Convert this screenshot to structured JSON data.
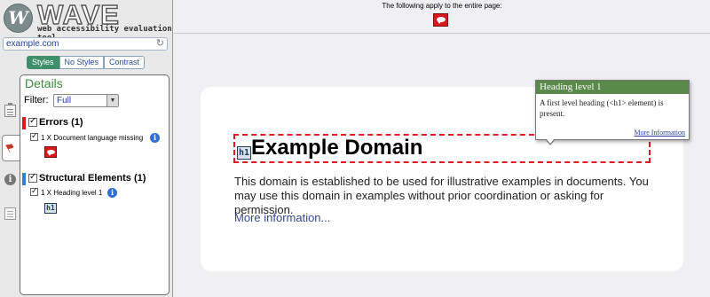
{
  "logo": {
    "mark": "W",
    "word": "WAVE",
    "tagline": "web accessibility evaluation tool"
  },
  "url_bar": {
    "value": "example.com",
    "reload_icon": "reload-icon"
  },
  "view_tabs": [
    {
      "label": "Styles",
      "active": true
    },
    {
      "label": "No Styles",
      "active": false
    },
    {
      "label": "Contrast",
      "active": false
    }
  ],
  "side_icons": [
    "clipboard-icon",
    "flag-icon",
    "info-icon",
    "document-icon"
  ],
  "details": {
    "title": "Details",
    "filter_label": "Filter:",
    "filter_value": "Full",
    "categories": [
      {
        "label": "Errors (1)",
        "color": "#d9181e",
        "checked": true,
        "items": [
          {
            "label": "1 X Document language missing",
            "checked": true,
            "icon": "error-icon"
          }
        ]
      },
      {
        "label": "Structural Elements (1)",
        "color": "#2a84d2",
        "checked": true,
        "items": [
          {
            "label": "1 X Heading level 1",
            "checked": true,
            "icon": "h1-icon",
            "icon_text": "h1"
          }
        ]
      }
    ]
  },
  "topbar": {
    "text": "The following apply to the entire page:"
  },
  "content": {
    "heading_icon_text": "h1",
    "heading": "Example Domain",
    "paragraph": "This domain is established to be used for illustrative examples in documents. You may use this domain in examples without prior coordination or asking for permission.",
    "link": "More information..."
  },
  "tooltip": {
    "title": "Heading level 1",
    "body": "A first level heading (<h1> element) is present.",
    "link": "More Information"
  },
  "colors": {
    "accent_green": "#3f8f6a",
    "error_red": "#d9181e",
    "structure_blue": "#2a84d2"
  }
}
